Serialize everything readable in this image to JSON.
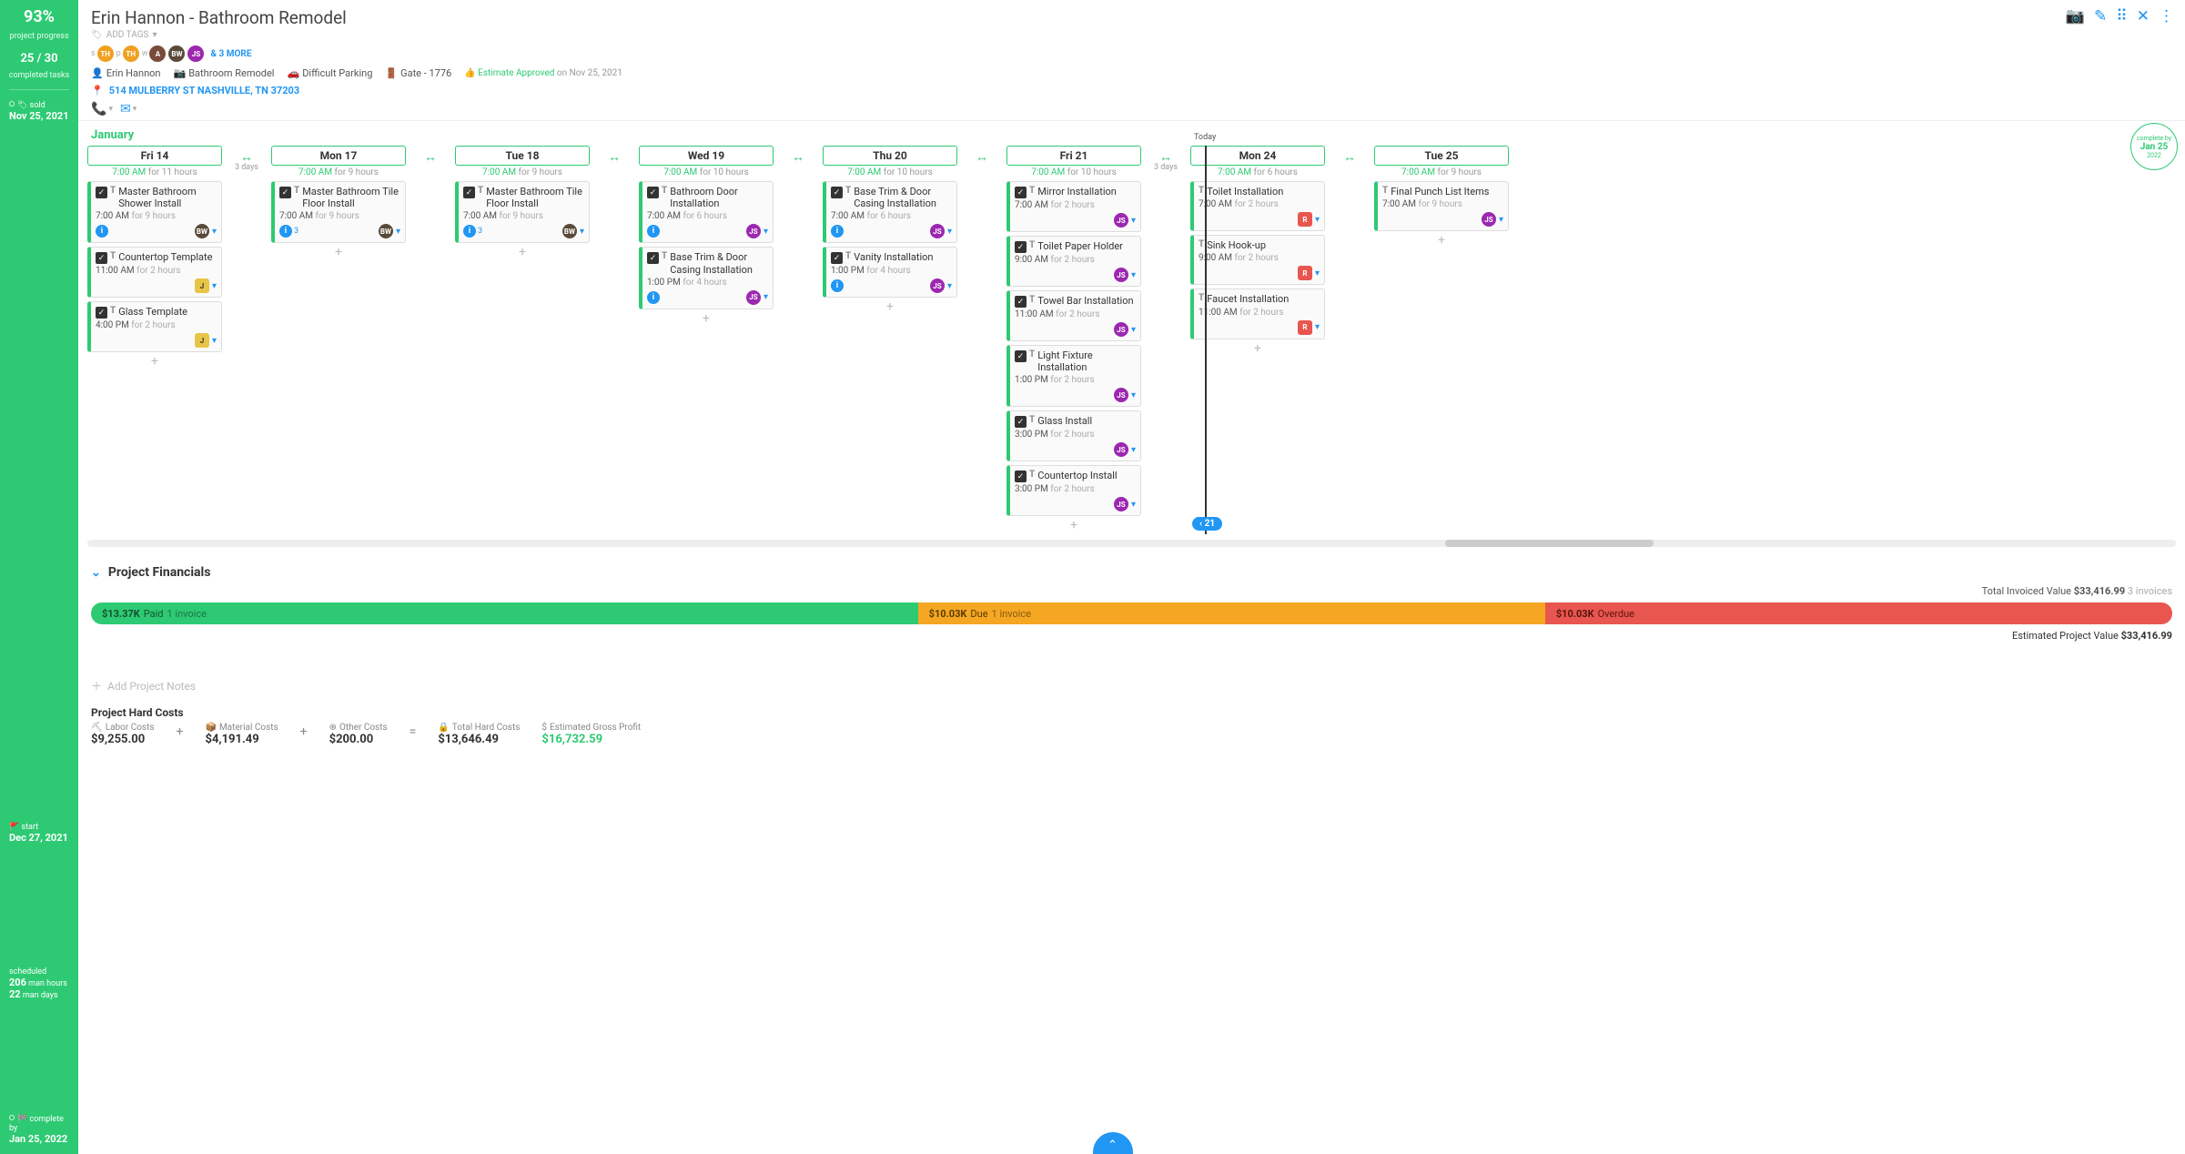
{
  "sidebar": {
    "progress_pct": "93%",
    "progress_label": "project progress",
    "ratio": "25 / 30",
    "ratio_label": "completed tasks",
    "sold_label": "sold",
    "sold_date": "Nov 25, 2021",
    "start_label": "start",
    "start_date": "Dec 27, 2021",
    "sched_label": "scheduled",
    "sched_hours": "206",
    "sched_hours_unit": "man hours",
    "sched_days": "22",
    "sched_days_unit": "man days",
    "complete_label": "complete by",
    "complete_date": "Jan 25, 2022"
  },
  "header": {
    "title": "Erin Hannon - Bathroom Remodel",
    "add_tags": "ADD TAGS",
    "more_link": "& 3 MORE",
    "client": "Erin Hannon",
    "project": "Bathroom Remodel",
    "parking": "Difficult Parking",
    "gate": "Gate - 1776",
    "approved": "Estimate Approved",
    "approved_on": "on Nov 25, 2021",
    "address": "514 MULBERRY ST NASHVILLE, TN 37203"
  },
  "timeline": {
    "month": "January",
    "today_label": "Today",
    "today_pill": "21",
    "gap1": "3 days",
    "gap2": "3 days",
    "complete_badge": {
      "top": "complete by",
      "mid": "Jan 25",
      "bot": "2022"
    },
    "days": [
      {
        "key": "fri14",
        "name": "Fri 14",
        "start": "7:00 AM",
        "dur": "for 11 hours",
        "tasks": [
          {
            "title": "Master Bathroom Shower Install",
            "time": "7:00 AM",
            "dur": "for 9 hours",
            "info": true,
            "assignee": "bw"
          },
          {
            "title": "Countertop Template",
            "time": "11:00 AM",
            "dur": "for 2 hours",
            "assignee": "j"
          },
          {
            "title": "Glass Template",
            "time": "4:00 PM",
            "dur": "for 2 hours",
            "assignee": "j"
          }
        ]
      },
      {
        "key": "mon17",
        "name": "Mon 17",
        "start": "7:00 AM",
        "dur": "for 9 hours",
        "tasks": [
          {
            "title": "Master Bathroom Tile Floor Install",
            "time": "7:00 AM",
            "dur": "for 9 hours",
            "info": true,
            "cnt": "3",
            "assignee": "bw"
          }
        ]
      },
      {
        "key": "tue18",
        "name": "Tue 18",
        "start": "7:00 AM",
        "dur": "for 9 hours",
        "tasks": [
          {
            "title": "Master Bathroom Tile Floor Install",
            "time": "7:00 AM",
            "dur": "for 9 hours",
            "info": true,
            "cnt": "3",
            "assignee": "bw"
          }
        ]
      },
      {
        "key": "wed19",
        "name": "Wed 19",
        "start": "7:00 AM",
        "dur": "for 10 hours",
        "tasks": [
          {
            "title": "Bathroom Door Installation",
            "time": "7:00 AM",
            "dur": "for 6 hours",
            "info": true,
            "assignee": "js"
          },
          {
            "title": "Base Trim & Door Casing Installation",
            "time": "1:00 PM",
            "dur": "for 4 hours",
            "info": true,
            "assignee": "js"
          }
        ]
      },
      {
        "key": "thu20",
        "name": "Thu 20",
        "start": "7:00 AM",
        "dur": "for 10 hours",
        "tasks": [
          {
            "title": "Base Trim & Door Casing Installation",
            "time": "7:00 AM",
            "dur": "for 6 hours",
            "info": true,
            "assignee": "js"
          },
          {
            "title": "Vanity Installation",
            "time": "1:00 PM",
            "dur": "for 4 hours",
            "info": true,
            "assignee": "js"
          }
        ]
      },
      {
        "key": "fri21",
        "name": "Fri 21",
        "start": "7:00 AM",
        "dur": "for 10 hours",
        "tasks": [
          {
            "title": "Mirror Installation",
            "time": "7:00 AM",
            "dur": "for 2 hours",
            "assignee": "js"
          },
          {
            "title": "Toilet Paper Holder",
            "time": "9:00 AM",
            "dur": "for 2 hours",
            "assignee": "js"
          },
          {
            "title": "Towel Bar Installation",
            "time": "11:00 AM",
            "dur": "for 2 hours",
            "assignee": "js"
          },
          {
            "title": "Light Fixture Installation",
            "time": "1:00 PM",
            "dur": "for 2 hours",
            "assignee": "js"
          },
          {
            "title": "Glass Install",
            "time": "3:00 PM",
            "dur": "for 2 hours",
            "assignee": "js"
          },
          {
            "title": "Countertop Install",
            "time": "3:00 PM",
            "dur": "for 2 hours",
            "assignee": "js"
          }
        ]
      },
      {
        "key": "mon24",
        "name": "Mon 24",
        "start": "7:00 AM",
        "dur": "for 6 hours",
        "tasks": [
          {
            "title": "Toilet Installation",
            "time": "7:00 AM",
            "dur": "for 2 hours",
            "assignee": "r",
            "nocheck": true
          },
          {
            "title": "Sink Hook-up",
            "time": "9:00 AM",
            "dur": "for 2 hours",
            "assignee": "r",
            "nocheck": true
          },
          {
            "title": "Faucet Installation",
            "time": "11:00 AM",
            "dur": "for 2 hours",
            "assignee": "r",
            "nocheck": true
          }
        ]
      },
      {
        "key": "tue25",
        "name": "Tue 25",
        "start": "7:00 AM",
        "dur": "for 9 hours",
        "tasks": [
          {
            "title": "Final Punch List Items",
            "time": "7:00 AM",
            "dur": "for 9 hours",
            "assignee": "js",
            "nocheck": true
          }
        ]
      }
    ]
  },
  "financials": {
    "title": "Project Financials",
    "invoiced_label": "Total Invoiced Value",
    "invoiced_value": "$33,416.99",
    "invoices_count": "3 invoices",
    "paid_amt": "$13.37K",
    "paid_lbl": "Paid",
    "paid_sub": "1 invoice",
    "due_amt": "$10.03K",
    "due_lbl": "Due",
    "due_sub": "1 invoice",
    "over_amt": "$10.03K",
    "over_lbl": "Overdue",
    "est_label": "Estimated Project Value",
    "est_value": "$33,416.99"
  },
  "notes": {
    "placeholder": "Add Project Notes"
  },
  "hardcosts": {
    "title": "Project Hard Costs",
    "labor_lbl": "Labor Costs",
    "labor": "$9,255.00",
    "material_lbl": "Material Costs",
    "material": "$4,191.49",
    "other_lbl": "Other Costs",
    "other": "$200.00",
    "total_lbl": "Total Hard Costs",
    "total": "$13,646.49",
    "profit_lbl": "Estimated Gross Profit",
    "profit": "$16,732.59"
  }
}
